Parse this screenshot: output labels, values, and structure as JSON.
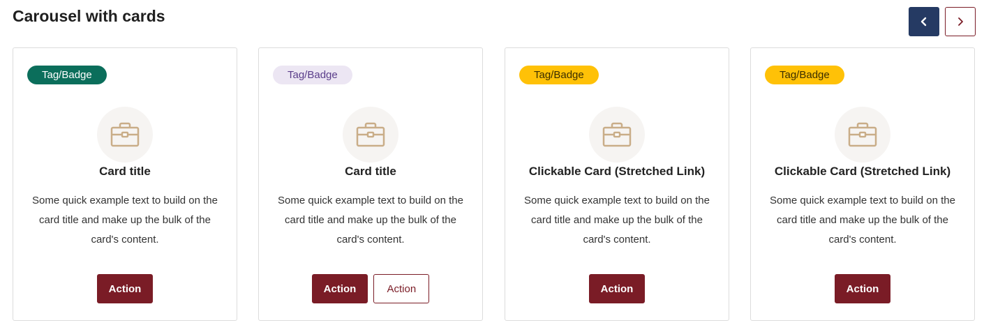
{
  "page": {
    "title": "Carousel with cards"
  },
  "carousel_nav": {
    "prev_icon": "chevron-left-icon",
    "next_icon": "chevron-right-icon"
  },
  "colors": {
    "primary": "#7a1c26",
    "nav_active": "#253a63",
    "badge_green": "#0b6e5b",
    "badge_lavender": "#ece6f3",
    "badge_yellow": "#ffc107",
    "icon_tan": "#c9ad88"
  },
  "cards": [
    {
      "badge": {
        "label": "Tag/Badge",
        "bg": "#0b6e5b",
        "fg": "#ffffff"
      },
      "icon": "briefcase-icon",
      "title": "Card title",
      "text": "Some quick example text to build on the card title and make up the bulk of the card's content.",
      "primary_action": "Action",
      "secondary_action": null
    },
    {
      "badge": {
        "label": "Tag/Badge",
        "bg": "#ece6f3",
        "fg": "#5a3d8a"
      },
      "icon": "briefcase-icon",
      "title": "Card title",
      "text": "Some quick example text to build on the card title and make up the bulk of the card's content.",
      "primary_action": "Action",
      "secondary_action": "Action"
    },
    {
      "badge": {
        "label": "Tag/Badge",
        "bg": "#ffc107",
        "fg": "#3a2e00"
      },
      "icon": "briefcase-icon",
      "title": "Clickable Card (Stretched Link)",
      "text": "Some quick example text to build on the card title and make up the bulk of the card's content.",
      "primary_action": "Action",
      "secondary_action": null
    },
    {
      "badge": {
        "label": "Tag/Badge",
        "bg": "#ffc107",
        "fg": "#3a2e00"
      },
      "icon": "briefcase-icon",
      "title": "Clickable Card (Stretched Link)",
      "text": "Some quick example text to build on the card title and make up the bulk of the card's content.",
      "primary_action": "Action",
      "secondary_action": null
    }
  ]
}
